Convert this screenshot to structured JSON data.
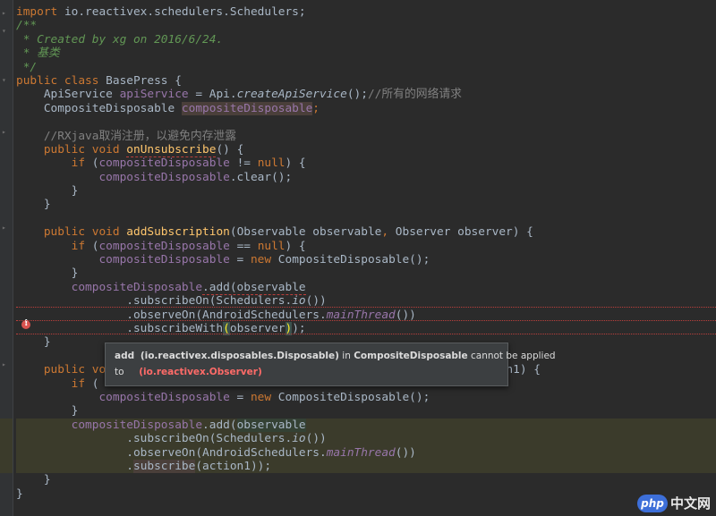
{
  "code": {
    "l1_import": "import",
    "l1_rest": " io.reactivex.schedulers.Schedulers;",
    "l2": "/**",
    "l3": " * Created by xg on 2016/6/24.",
    "l4": " * 基类",
    "l5": " */",
    "l6_kw": "public class",
    "l6_rest": " BasePress {",
    "l7_type": "    ApiService ",
    "l7_field": "apiService",
    "l7_eq": " = Api.",
    "l7_call": "createApiService",
    "l7_end": "();",
    "l7_comment": "//所有的网络请求",
    "l8_type": "    CompositeDisposable ",
    "l8_field": "compositeDisposable",
    "l8_end": ";",
    "l10_comment": "    //RXjava取消注册，以避免内存泄露",
    "l11_kw": "    public void ",
    "l11_fn": "onUnsubscribe",
    "l11_end": "() {",
    "l12_kw": "        if ",
    "l12_open": "(",
    "l12_field": "compositeDisposable",
    "l12_op": " != ",
    "l12_null": "null",
    "l12_end": ") {",
    "l13_field": "            compositeDisposable",
    "l13_end": ".clear();",
    "l14": "        }",
    "l15": "    }",
    "l17_kw": "    public void ",
    "l17_fn": "addSubscription",
    "l17_args": "(Observable observable",
    "l17_comma": ", ",
    "l17_args2": "Observer observer) {",
    "l18_kw": "        if ",
    "l18_open": "(",
    "l18_field": "compositeDisposable",
    "l18_op": " == ",
    "l18_null": "null",
    "l18_end": ") {",
    "l19_field": "            compositeDisposable",
    "l19_eq": " = ",
    "l19_new": "new",
    "l19_end": " CompositeDisposable();",
    "l20": "        }",
    "l21_field": "        compositeDisposable",
    "l21_end": ".add(observable",
    "l22_pre": "                .subscribeOn(Schedulers.",
    "l22_io": "io",
    "l22_end": "())",
    "l23_pre": "                .observeOn(AndroidSchedulers.",
    "l23_main": "mainThread",
    "l23_end": "())",
    "l24_pre": "                .subscribeWith",
    "l24_p1": "(",
    "l24_mid": "observer",
    "l24_p2": ")",
    "l24_end": ");",
    "l25": "    }",
    "l27_kw": "    public vo",
    "l27_tail": "ion1) {",
    "l28_kw": "        if ",
    "l28_open": "(",
    "l29_field": "            compositeDisposable",
    "l29_eq": " = ",
    "l29_new": "new",
    "l29_end": " CompositeDisposable();",
    "l30": "        }",
    "l31_field": "        compositeDisposable",
    "l31_add": ".add(",
    "l31_obs": "observable",
    "l32_pre": "                .subscribeOn(Schedulers.",
    "l32_io": "io",
    "l32_end": "())",
    "l33_pre": "                .observeOn(AndroidSchedulers.",
    "l33_main": "mainThread",
    "l33_end": "())",
    "l34_pre": "                .",
    "l34_sub": "subscribe",
    "l34_end": "(action1));",
    "l35": "    }",
    "l36": "}"
  },
  "tooltip": {
    "method": "add",
    "param": "(io.reactivex.disposables.Disposable)",
    "in": " in ",
    "cls": "CompositeDisposable",
    "msg": " cannot be applied",
    "to": "to",
    "arg": "(io.reactivex.Observer)"
  },
  "watermark": {
    "logo": "php",
    "text": "中文网"
  },
  "colors": {
    "background": "#2b2b2b",
    "keyword": "#cc7832",
    "field": "#9876aa",
    "method": "#ffc66d",
    "error": "#bc3f3c"
  }
}
